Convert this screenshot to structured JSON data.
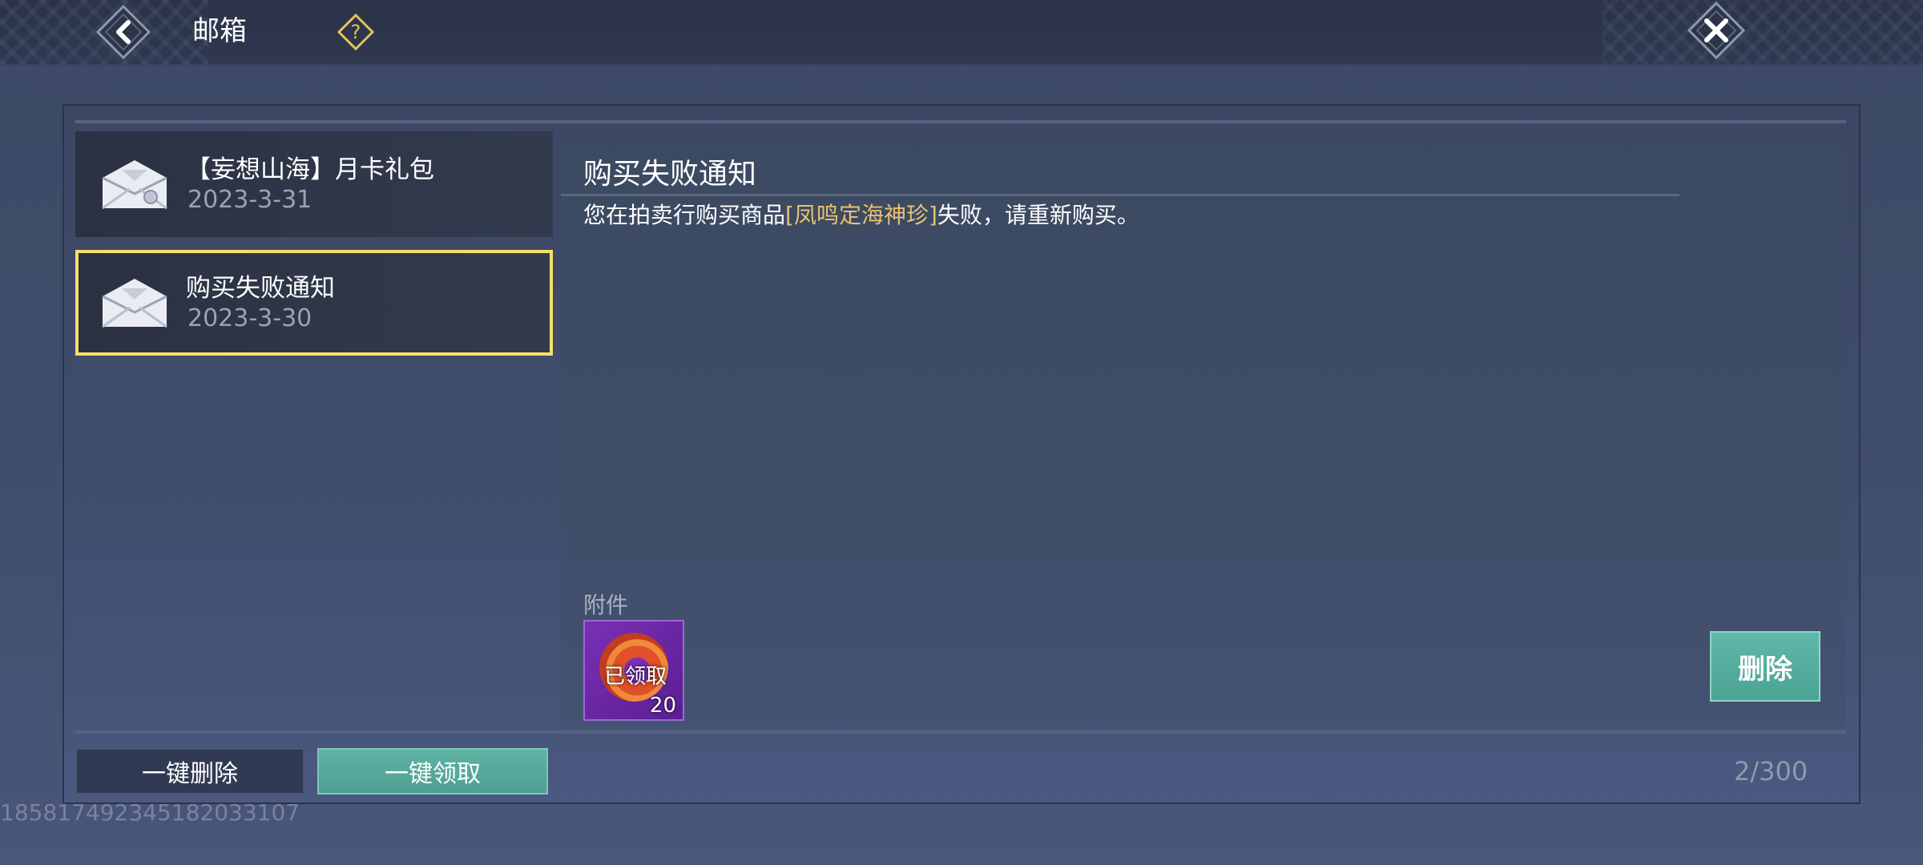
{
  "header": {
    "title": "邮箱",
    "back_icon": "back-arrow-icon",
    "help_icon": "question-icon",
    "close_icon": "close-x-icon"
  },
  "mail_list": [
    {
      "title": "【妄想山海】月卡礼包",
      "date": "2023-3-31",
      "selected": false
    },
    {
      "title": "购买失败通知",
      "date": "2023-3-30",
      "selected": true
    }
  ],
  "detail": {
    "title": "购买失败通知",
    "body_prefix": "您在拍卖行购买商品",
    "body_item": "[凤鸣定海神珍]",
    "body_suffix": "失败，请重新购买。",
    "attachments_label": "附件",
    "attachment": {
      "status": "已领取",
      "quantity": "20"
    },
    "delete_label": "删除"
  },
  "footer": {
    "delete_all_label": "一键删除",
    "claim_all_label": "一键领取",
    "count": "2/300",
    "uid": "1858174923451820331​07"
  },
  "colors": {
    "accent_teal": "#5fb3a4",
    "highlight_yellow": "#f5e06a",
    "item_name_gold": "#e8c170"
  }
}
